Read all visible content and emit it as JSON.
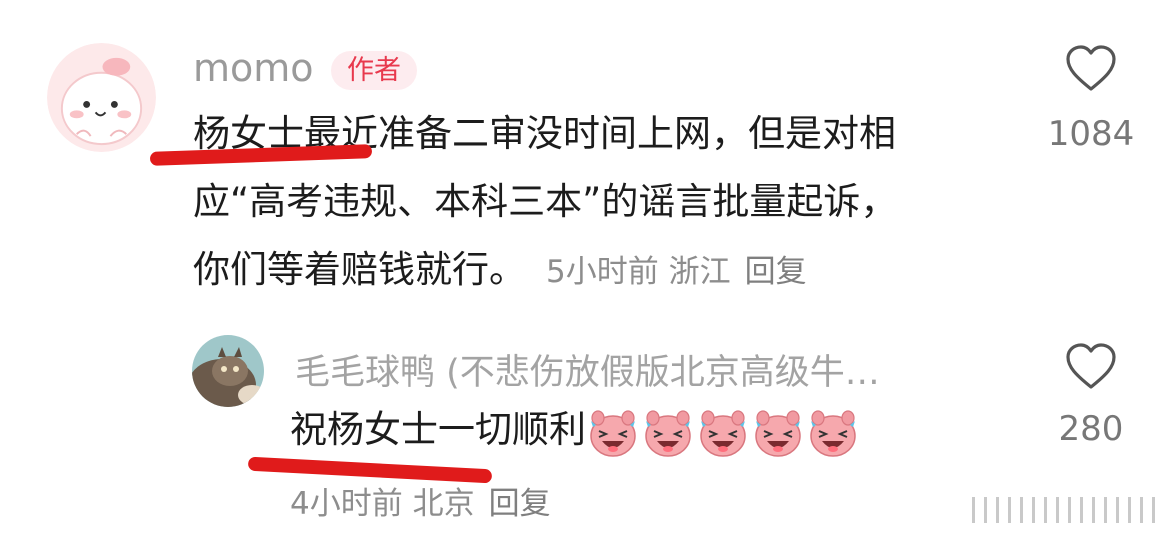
{
  "comments": [
    {
      "username": "momo",
      "badge": "作者",
      "lines": [
        "杨女士最近准备二审没时间上网，但是对相",
        "应“高考违规、本科三本”的谣言批量起诉，",
        "你们等着赔钱就行。"
      ],
      "time": "5小时前",
      "location": "浙江",
      "reply_label": "回复",
      "likes": "1084"
    },
    {
      "username": "毛毛球鸭 (不悲伤放假版北京高级牛…",
      "text": "祝杨女士一切顺利",
      "time": "4小时前",
      "location": "北京",
      "reply_label": "回复",
      "likes": "280",
      "emoji_count": 5
    }
  ],
  "colors": {
    "username": "#9a9a9a",
    "badge_bg": "#fdecef",
    "badge_text": "#e8394d",
    "annotation": "#e01b1b",
    "meta": "#8d8d8d"
  },
  "icons": [
    "heart-outline-icon",
    "laughing-pig-emoji"
  ]
}
